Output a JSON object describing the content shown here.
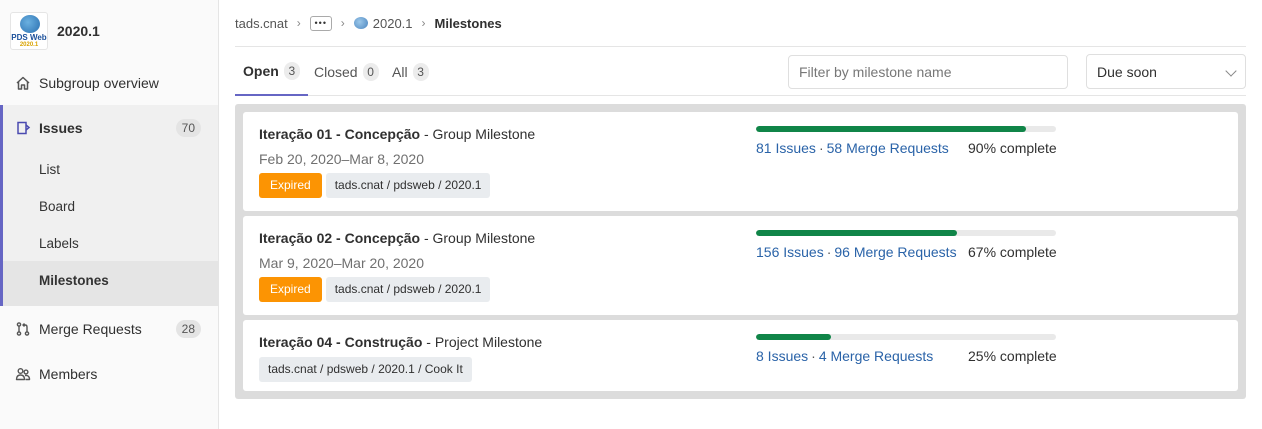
{
  "context": {
    "logo_text": "PDS Web",
    "logo_sub": "2020.1",
    "title": "2020.1"
  },
  "sidebar": {
    "overview_label": "Subgroup overview",
    "issues_label": "Issues",
    "issues_count": "70",
    "sub_items": [
      "List",
      "Board",
      "Labels",
      "Milestones"
    ],
    "merge_requests_label": "Merge Requests",
    "merge_requests_count": "28",
    "members_label": "Members"
  },
  "breadcrumb": {
    "root": "tads.cnat",
    "ellipsis": "•••",
    "group": "2020.1",
    "current": "Milestones"
  },
  "tabs": [
    {
      "label": "Open",
      "count": "3"
    },
    {
      "label": "Closed",
      "count": "0"
    },
    {
      "label": "All",
      "count": "3"
    }
  ],
  "filter": {
    "placeholder": "Filter by milestone name",
    "value": ""
  },
  "sort": {
    "selected": "Due soon"
  },
  "milestones": [
    {
      "name": "Iteração 01 - Concepção",
      "kind": " - Group Milestone",
      "dates": "Feb 20, 2020–Mar 8, 2020",
      "status": "Expired",
      "path": "tads.cnat / pdsweb / 2020.1",
      "issues": "81 Issues",
      "merge_requests": "58 Merge Requests",
      "percent": 90,
      "percent_text": "90% complete"
    },
    {
      "name": "Iteração 02 - Concepção",
      "kind": " - Group Milestone",
      "dates": "Mar 9, 2020–Mar 20, 2020",
      "status": "Expired",
      "path": "tads.cnat / pdsweb / 2020.1",
      "issues": "156 Issues",
      "merge_requests": "96 Merge Requests",
      "percent": 67,
      "percent_text": "67% complete"
    },
    {
      "name": "Iteração 04 - Construção",
      "kind": " - Project Milestone",
      "dates": "",
      "status": "",
      "path": "tads.cnat / pdsweb / 2020.1 / Cook It",
      "issues": "8 Issues",
      "merge_requests": "4 Merge Requests",
      "percent": 25,
      "percent_text": "25% complete"
    }
  ],
  "colors": {
    "accent": "#6666c4",
    "progress": "#108548",
    "expired": "#fc9403",
    "link": "#2a63a8"
  }
}
